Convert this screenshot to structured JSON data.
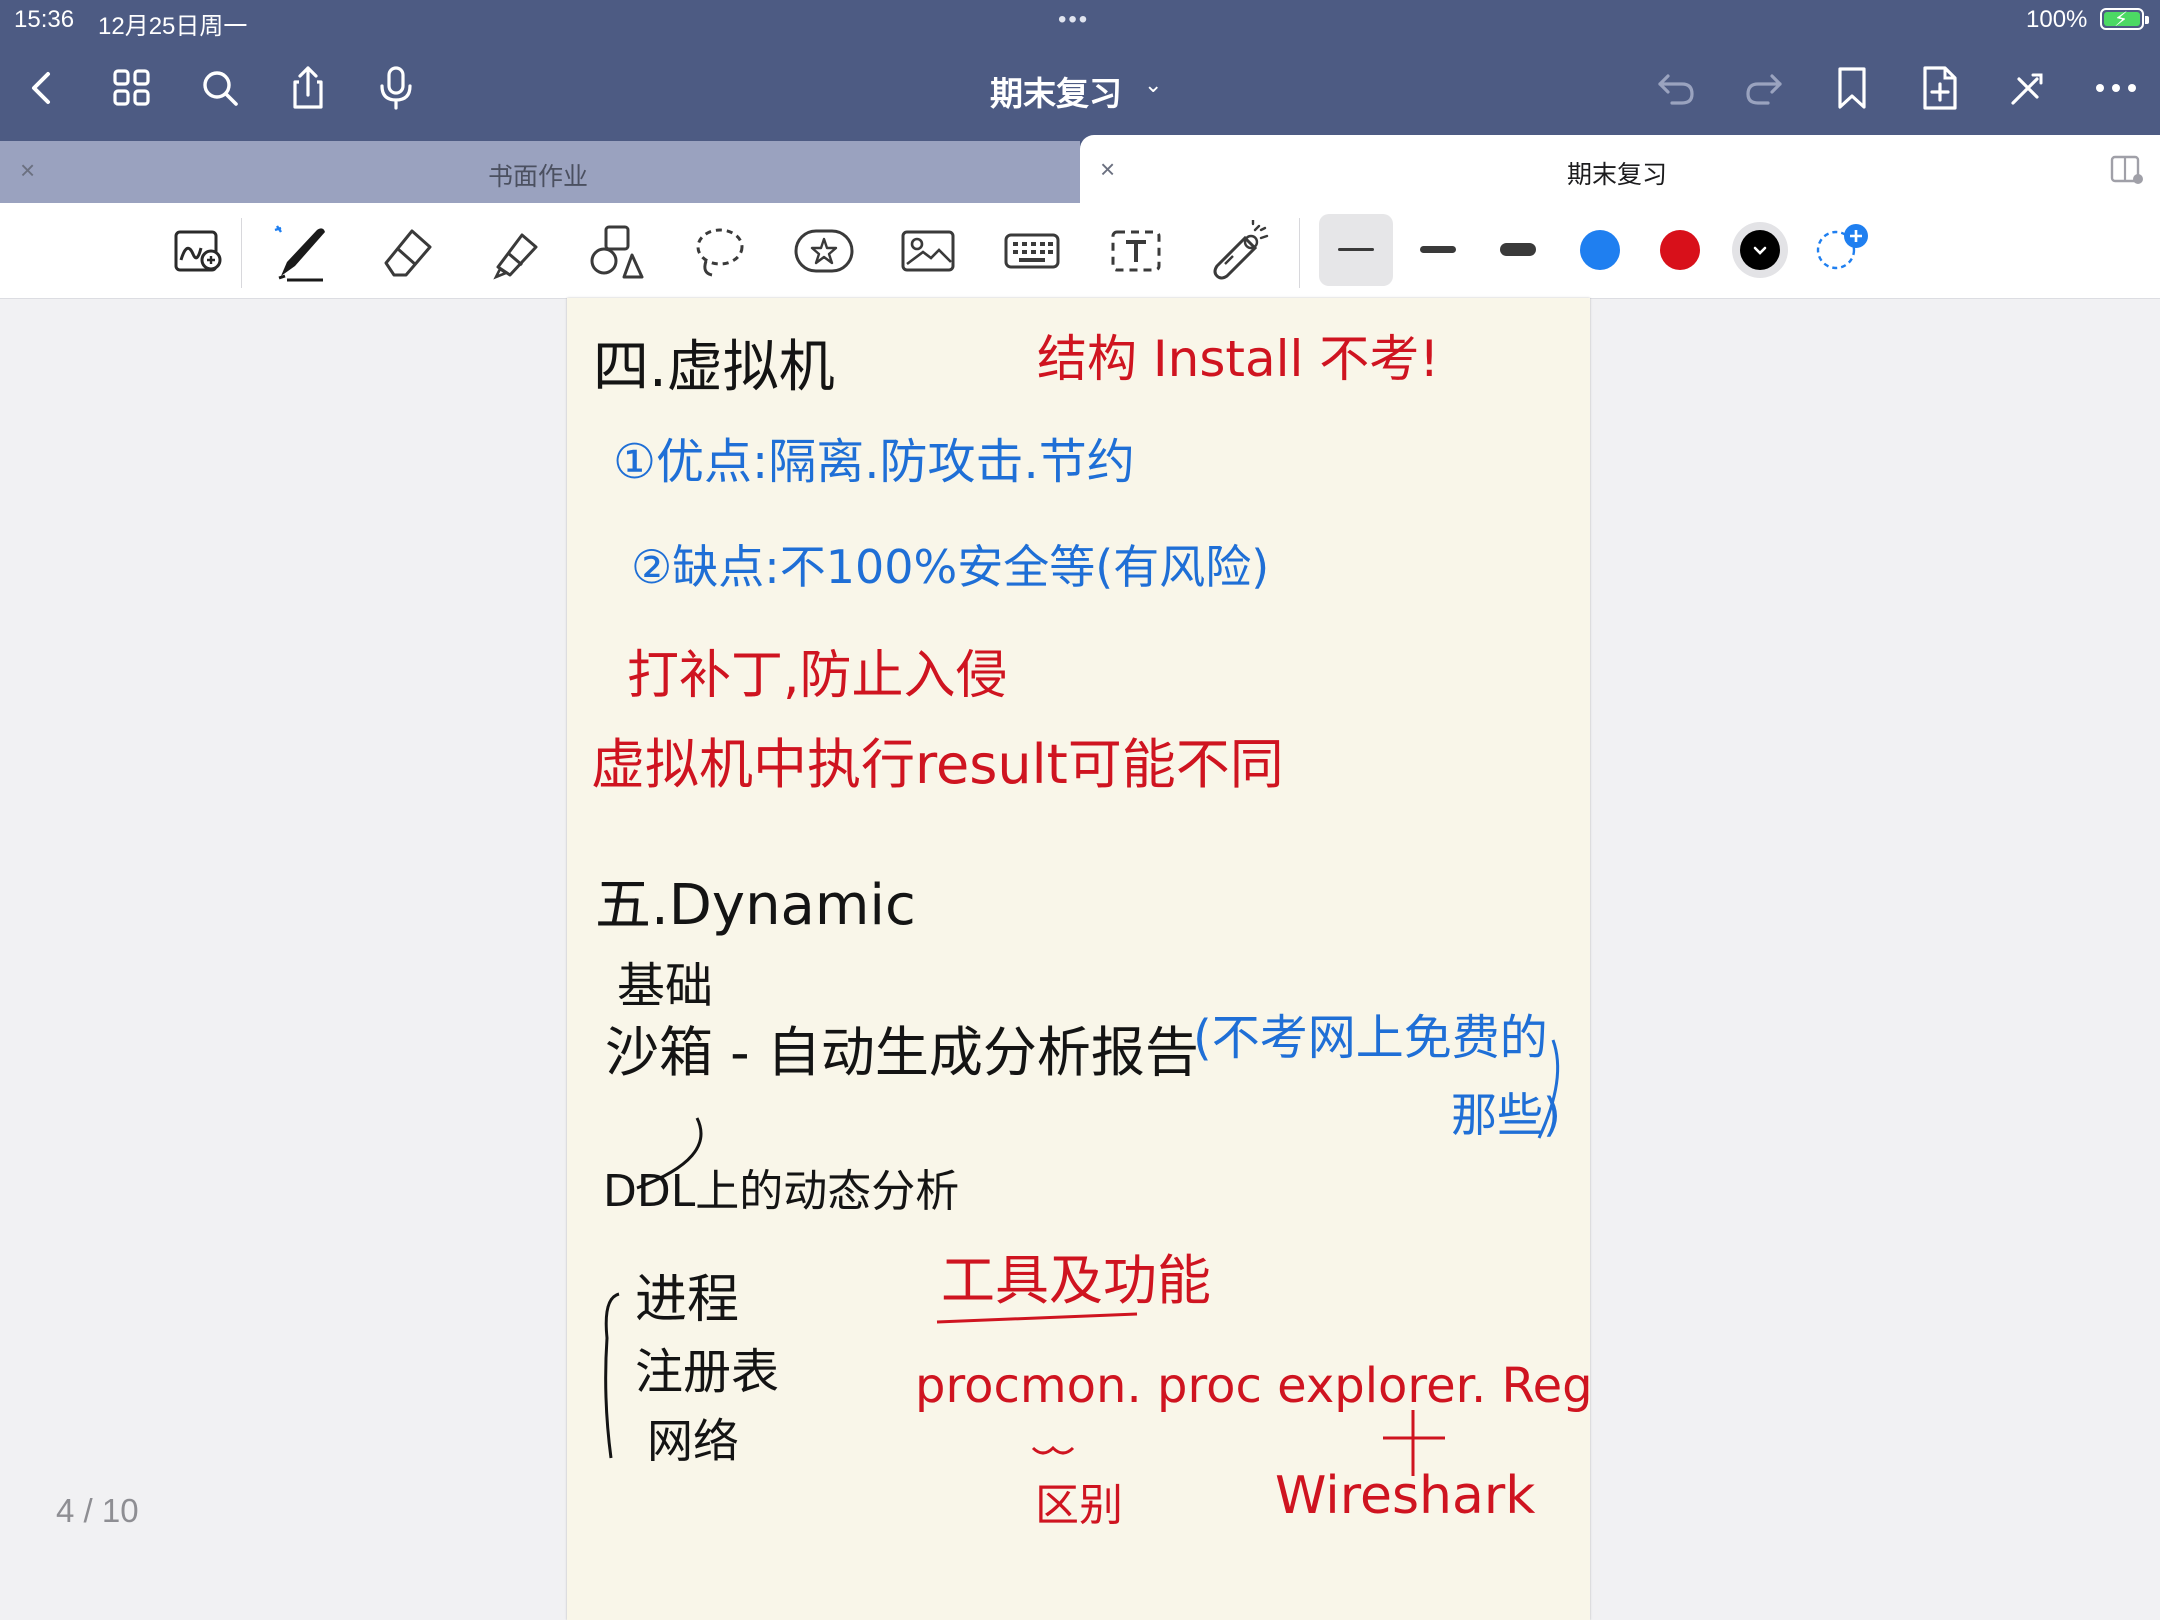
{
  "status_bar": {
    "time": "15:36",
    "date": "12月25日周一",
    "battery": "100%",
    "multitask_dots": "•••"
  },
  "top_toolbar": {
    "document_title": "期末复习",
    "title_chevron": "⌄",
    "left_icons": [
      "back-icon",
      "grid-icon",
      "search-icon",
      "share-icon",
      "microphone-icon"
    ],
    "right_icons": [
      "undo-icon",
      "redo-icon",
      "bookmark-icon",
      "add-page-icon",
      "close-toolbar-icon",
      "more-icon"
    ]
  },
  "tabs": [
    {
      "label": "书面作业",
      "close": "×",
      "active": false
    },
    {
      "label": "期末复习",
      "close": "×",
      "active": true
    }
  ],
  "drawing_tools": [
    "zoom-window-icon",
    "pen-icon",
    "eraser-icon",
    "highlighter-icon",
    "shapes-icon",
    "lasso-icon",
    "sticker-icon",
    "image-icon",
    "keyboard-icon",
    "text-box-icon",
    "laser-pointer-icon"
  ],
  "pen_options": {
    "stroke_widths": [
      "thin",
      "medium",
      "thick"
    ],
    "selected_stroke": "thin",
    "colors": [
      "#1f7ff0",
      "#d8101a",
      "#000000"
    ],
    "selected_color": "#000000",
    "add_color_icon": "+"
  },
  "page_counter": "4 / 10",
  "notes": {
    "section4_title": "四.虚拟机",
    "section4_remark": "结构 Install 不考!",
    "advantages": "①优点:隔离.防攻击.节约",
    "disadvantages": "②缺点:不100%安全等(有风险)",
    "patch": "打补丁,防止入侵",
    "vm_result": "虚拟机中执行result可能不同",
    "section5_title": "五.Dynamic",
    "basics": "基础",
    "sandbox": "沙箱 - 自动生成分析报告",
    "sandbox_remark": "(不考网上免费的",
    "sandbox_remark2": "那些)",
    "ddl": "DDL上的动态分析",
    "process": "进程",
    "registry": "注册表",
    "network": "网络",
    "tools_title": "工具及功能",
    "tools_list": "procmon. proc explorer. Regshot.",
    "difference": "区别",
    "wireshark": "Wireshark"
  }
}
